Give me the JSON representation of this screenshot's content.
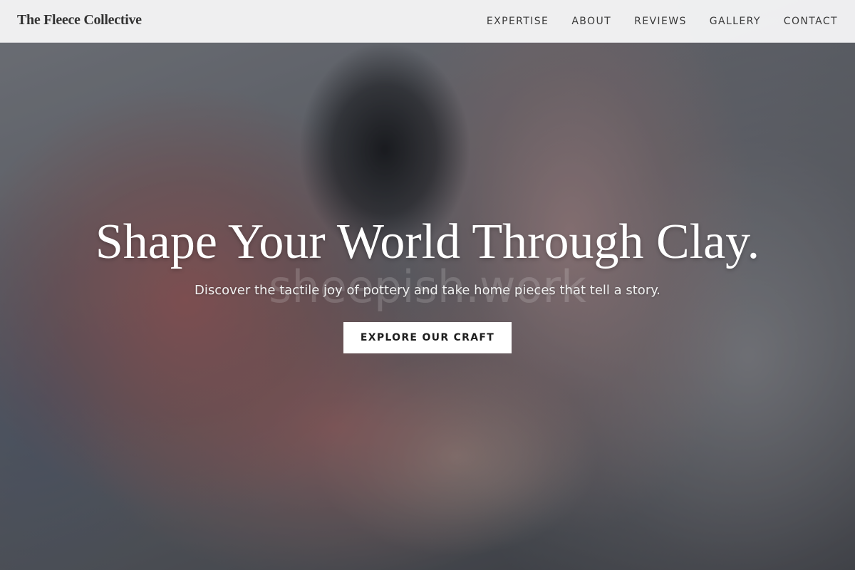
{
  "header": {
    "brand": "The Fleece Collective",
    "nav": [
      {
        "label": "EXPERTISE"
      },
      {
        "label": "ABOUT"
      },
      {
        "label": "REVIEWS"
      },
      {
        "label": "GALLERY"
      },
      {
        "label": "CONTACT"
      }
    ]
  },
  "hero": {
    "title": "Shape Your World Through Clay.",
    "subtitle": "Discover the tactile joy of pottery and take home pieces that tell a story.",
    "cta_label": "EXPLORE OUR CRAFT",
    "watermark": "sheepish.work",
    "image": "hands-shaping-clay-on-pottery-wheel"
  },
  "colors": {
    "navbar_bg": "#f5f5f6",
    "brand_text": "#333333",
    "nav_text": "#3a3a3a",
    "hero_text": "#ffffff",
    "cta_bg": "#ffffff",
    "cta_text": "#1e1e1e"
  }
}
